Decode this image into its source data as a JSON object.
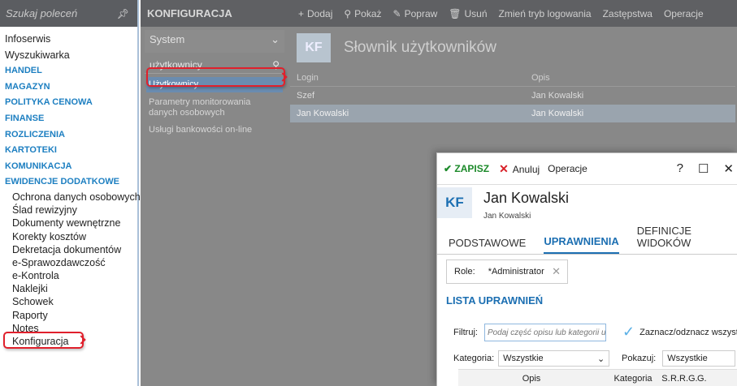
{
  "left": {
    "search_placeholder": "Szukaj poleceń",
    "items": [
      {
        "label": "Infoserwis",
        "type": "plain"
      },
      {
        "label": "Wyszukiwarka",
        "type": "plain"
      },
      {
        "label": "HANDEL",
        "type": "sec"
      },
      {
        "label": "MAGAZYN",
        "type": "sec"
      },
      {
        "label": "POLITYKA CENOWA",
        "type": "sec"
      },
      {
        "label": "FINANSE",
        "type": "sec"
      },
      {
        "label": "ROZLICZENIA",
        "type": "sec"
      },
      {
        "label": "KARTOTEKI",
        "type": "sec"
      },
      {
        "label": "KOMUNIKACJA",
        "type": "sec"
      },
      {
        "label": "EWIDENCJE DODATKOWE",
        "type": "sec"
      }
    ],
    "sub_items": [
      "Ochrona danych osobowych",
      "Ślad rewizyjny",
      "Dokumenty wewnętrzne",
      "Korekty kosztów",
      "Dekretacja dokumentów",
      "e-Sprawozdawczość",
      "e-Kontrola",
      "Naklejki",
      "Schowek",
      "Raporty",
      "Notes",
      "Konfiguracja"
    ]
  },
  "mid": {
    "header": "KONFIGURACJA",
    "system": "System",
    "filter": "użytkownicy",
    "items": [
      "Użytkownicy",
      "Parametry monitorowania danych osobowych",
      "Usługi bankowości on-line"
    ]
  },
  "toolbar": {
    "add": "Dodaj",
    "show": "Pokaż",
    "edit": "Popraw",
    "delete": "Usuń",
    "login_mode": "Zmień tryb logowania",
    "substitutes": "Zastępstwa",
    "operations": "Operacje"
  },
  "list": {
    "badge": "KF",
    "title": "Słownik użytkowników",
    "col_login": "Login",
    "col_opis": "Opis",
    "rows": [
      {
        "login": "Szef",
        "opis": "Jan Kowalski"
      },
      {
        "login": "Jan Kowalski",
        "opis": "Jan Kowalski"
      }
    ]
  },
  "dialog": {
    "save": "ZAPISZ",
    "cancel": "Anuluj",
    "operations": "Operacje",
    "help": "?",
    "badge": "KF",
    "name": "Jan Kowalski",
    "subname": "Jan Kowalski",
    "tabs": [
      "PODSTAWOWE",
      "UPRAWNIENIA",
      "DEFINICJE WIDOKÓW"
    ],
    "role_label": "Role:",
    "role_value": "*Administrator",
    "list_title": "LISTA UPRAWNIEŃ",
    "filter_label": "Filtruj:",
    "filter_placeholder": "Podaj część opisu lub kategorii u",
    "toggle_all": "Zaznacz/odznacz wszyst",
    "category_label": "Kategoria:",
    "category_value": "Wszystkie",
    "show_label": "Pokazuj:",
    "show_value": "Wszystkie",
    "col_opis": "Opis",
    "col_kategoria": "Kategoria",
    "col_marks": [
      "S.",
      "R.",
      "R.",
      "G.",
      "G."
    ]
  }
}
